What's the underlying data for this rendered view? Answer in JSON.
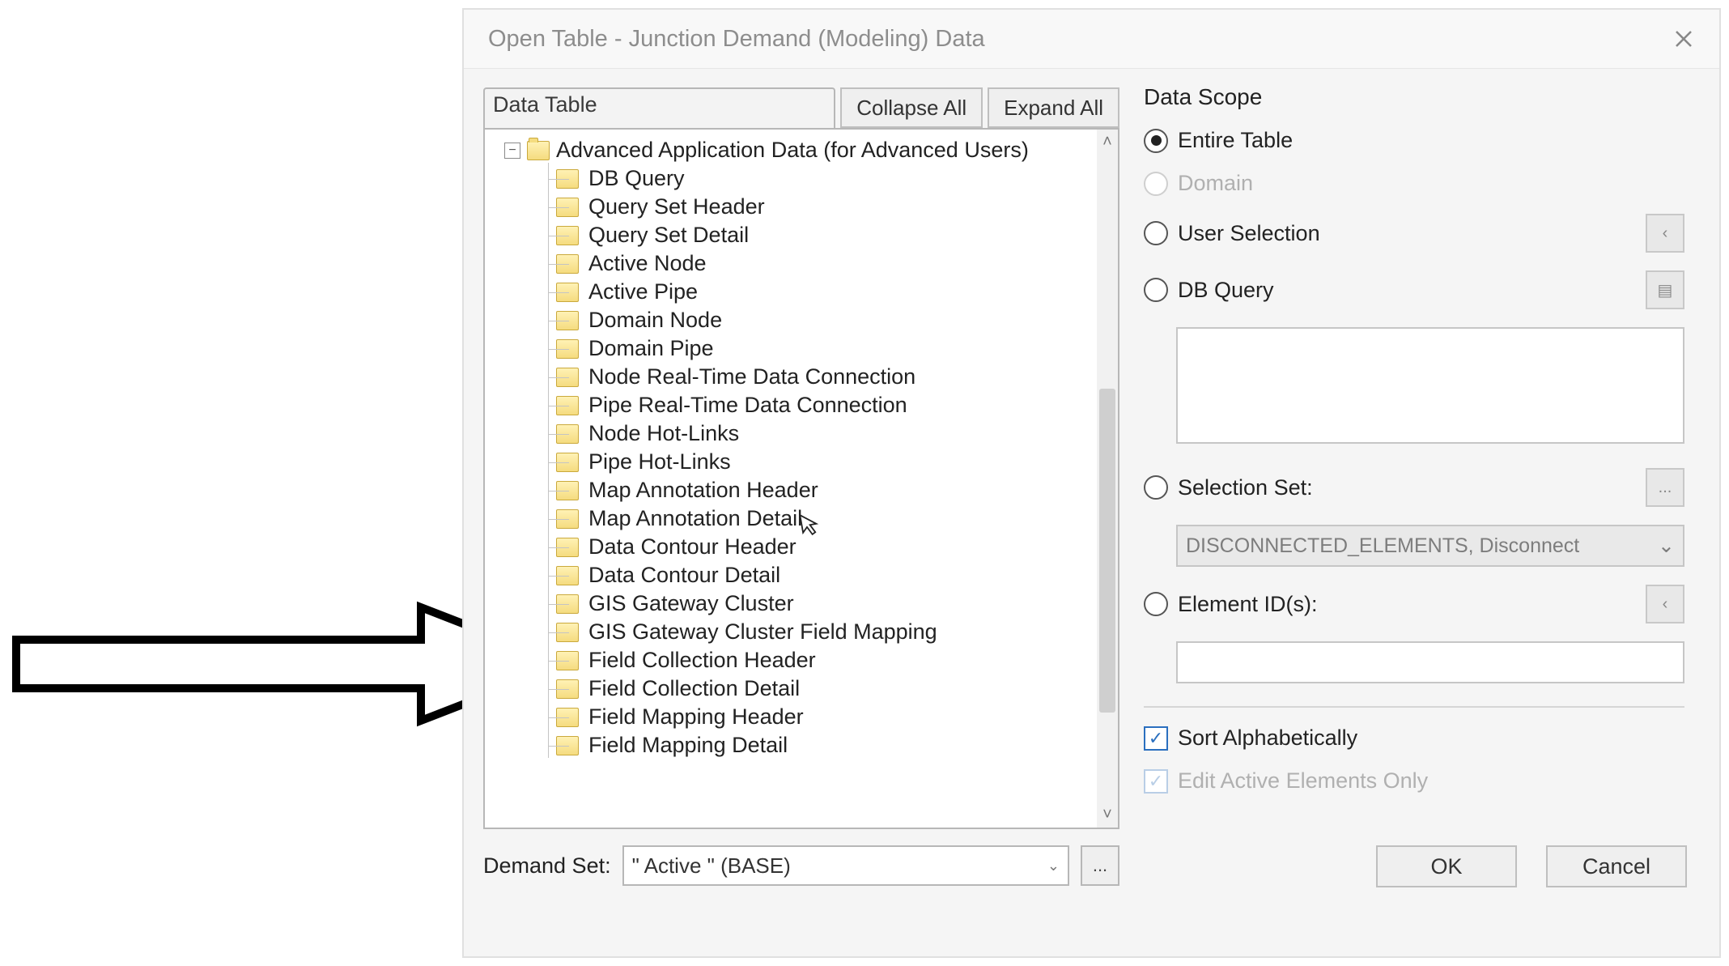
{
  "window": {
    "title": "Open Table - Junction Demand (Modeling) Data"
  },
  "left": {
    "tab_label": "Data Table",
    "collapse_btn": "Collapse All",
    "expand_btn": "Expand All",
    "root_label": "Advanced Application Data (for Advanced Users)",
    "items": [
      "DB Query",
      "Query Set Header",
      "Query Set Detail",
      "Active Node",
      "Active Pipe",
      "Domain Node",
      "Domain Pipe",
      "Node Real-Time Data Connection",
      "Pipe Real-Time Data Connection",
      "Node Hot-Links",
      "Pipe Hot-Links",
      "Map Annotation Header",
      "Map Annotation Detail",
      "Data Contour Header",
      "Data Contour Detail",
      "GIS Gateway Cluster",
      "GIS Gateway Cluster Field Mapping",
      "Field Collection Header",
      "Field Collection Detail",
      "Field Mapping Header",
      "Field Mapping Detail"
    ],
    "demand_label": "Demand Set:",
    "demand_value": "\" Active \" (BASE)"
  },
  "right": {
    "scope_title": "Data Scope",
    "entire_table": "Entire Table",
    "domain": "Domain",
    "user_selection": "User Selection",
    "db_query": "DB Query",
    "selection_set": "Selection Set:",
    "selection_set_value": "DISCONNECTED_ELEMENTS, Disconnect",
    "element_ids": "Element ID(s):",
    "sort_alpha": "Sort Alphabetically",
    "edit_active": "Edit Active Elements Only",
    "ok": "OK",
    "cancel": "Cancel"
  }
}
